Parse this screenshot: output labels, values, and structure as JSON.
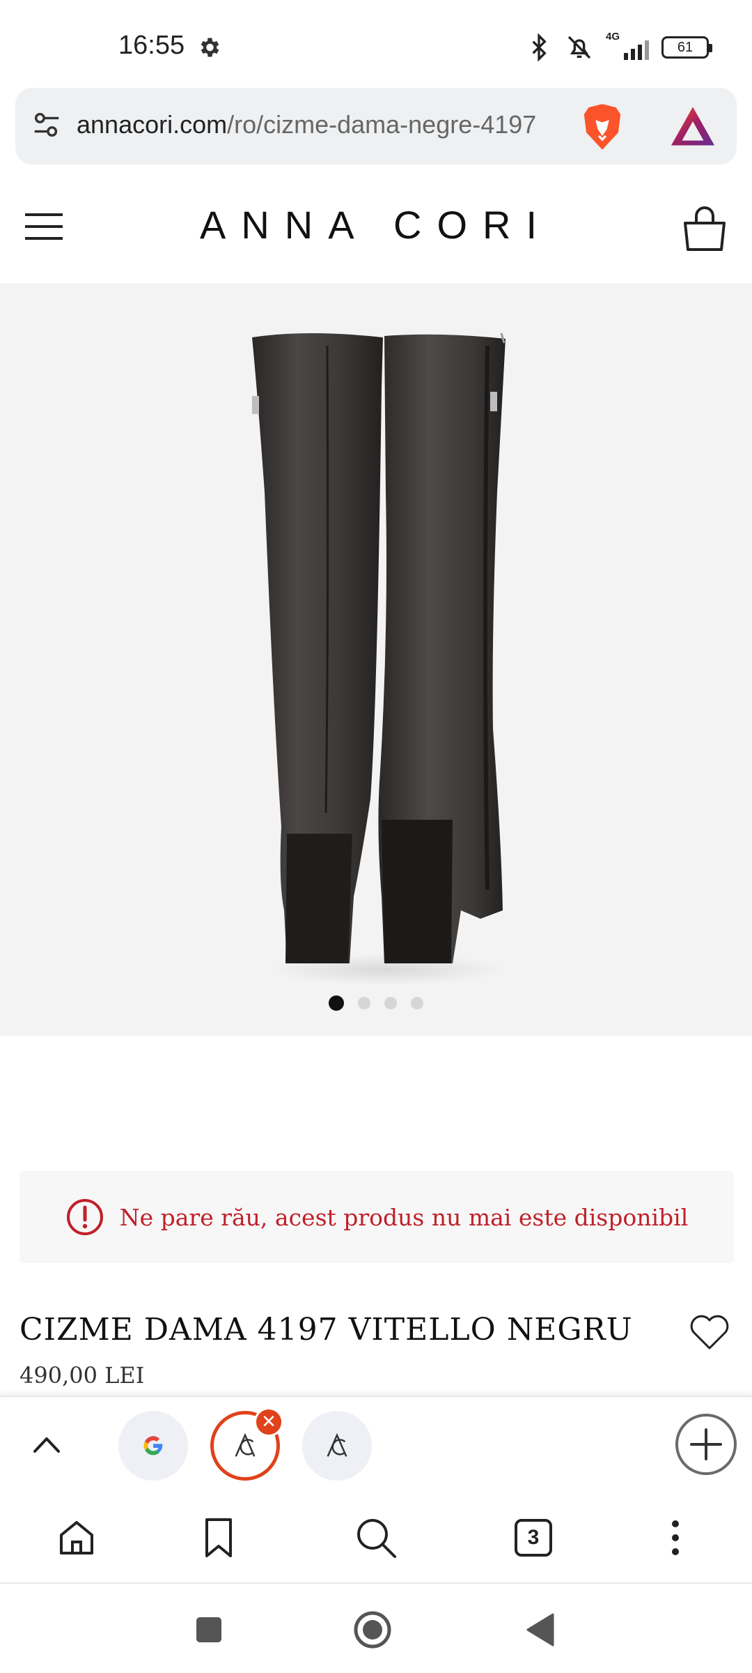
{
  "status_bar": {
    "time": "16:55",
    "network": "4G",
    "battery": "61"
  },
  "url_bar": {
    "host": "annacori.com",
    "path": "/ro/cizme-dama-negre-4197"
  },
  "site": {
    "brand": "ANNA CORI"
  },
  "gallery": {
    "image_count": 4,
    "active_index": 0
  },
  "alert": {
    "message": "Ne pare rău, acest produs nu mai este disponibil",
    "color": "#c0202a"
  },
  "product": {
    "title": "CIZME DAMA 4197 VITELLO NEGRU",
    "price": "490,00 LEI"
  },
  "tab_strip": {
    "tabs": [
      {
        "icon": "google-icon",
        "active": false
      },
      {
        "icon": "anna-cori-favicon",
        "active": true
      },
      {
        "icon": "anna-cori-favicon",
        "active": false
      }
    ],
    "accent": "#e0421b"
  },
  "toolbar": {
    "tab_count": "3"
  }
}
